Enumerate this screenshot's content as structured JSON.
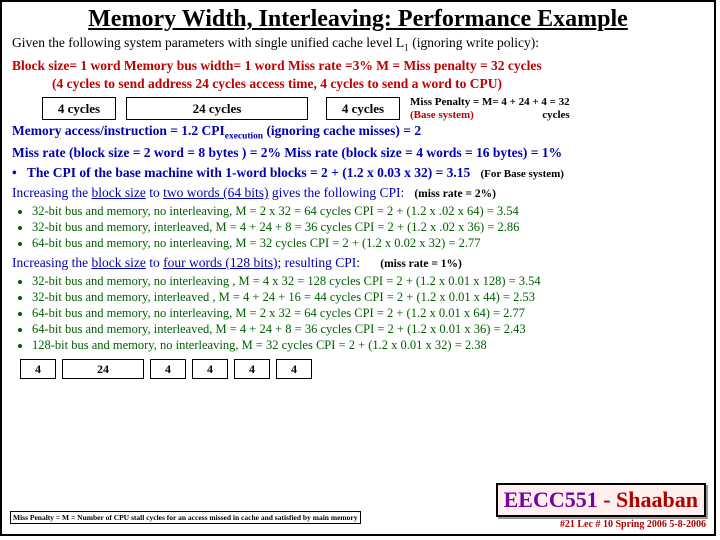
{
  "title": "Memory Width, Interleaving: Performance Example",
  "given": {
    "part1": "Given the following system parameters with single unified cache level L",
    "sub": "1",
    "part2": " (ignoring write policy):"
  },
  "params": {
    "line1": "Block size= 1 word   Memory bus width= 1  word    Miss rate =3%   M = Miss penalty = 32 cycles",
    "line2": "(4 cycles to send address     24 cycles  access time,   4 cycles to send a word to CPU)"
  },
  "cyclebox": {
    "a": "4 cycles",
    "b": "24 cycles",
    "c": "4 cycles"
  },
  "penalty": {
    "line1": "Miss Penalty = M= 4 + 24 + 4 = 32",
    "line2": "cycles",
    "base": "(Base system)"
  },
  "blue": {
    "l1a": "Memory access/instruction = 1.2        CPI",
    "l1sub": "execution",
    "l1b": " (ignoring cache misses) = 2",
    "l2": "Miss rate (block size = 2 word = 8 bytes ) =  2%    Miss rate  (block size = 4 words = 16 bytes) = 1%"
  },
  "base_cpi": {
    "text": "The CPI of the base machine with 1-word blocks =  2 + (1.2 x 0.03 x 32) = 3.15",
    "note": "(For Base system)"
  },
  "inc64": {
    "p1": "Increasing the ",
    "u1": "block size",
    "p2": " to ",
    "u2": "two words (64 bits)",
    "p3": " gives the following CPI:",
    "note": "(miss rate = 2%)"
  },
  "list64": [
    "32-bit bus and memory, no interleaving,   M = 2 x 32 = 64 cycles             CPI = 2 + (1.2 x  .02 x 64) = 3.54",
    "32-bit bus and memory, interleaved,    M = 4 + 24 + 8  = 36 cycles           CPI = 2 + (1.2 x  .02 x 36) =  2.86",
    "64-bit bus and memory, no interleaving,     M = 32 cycles                        CPI = 2 + (1.2 x 0.02 x 32) =  2.77"
  ],
  "inc128": {
    "p1": "Increasing the ",
    "u1": "block size",
    "p2": " to ",
    "u2": "four words (128 bits)",
    "p3": "; resulting CPI:",
    "note": "(miss rate = 1%)"
  },
  "list128": [
    "32-bit bus and memory, no interleaving ,   M = 4 x 32 = 128 cycles    CPI = 2 + (1.2 x 0.01 x 128) =  3.54",
    "32-bit bus and memory, interleaved ,   M = 4 + 24 + 16 =  44 cycles    CPI = 2 + (1.2 x 0.01 x 44)  =  2.53",
    "64-bit bus and memory, no interleaving,   M = 2 x 32 =   64 cycles      CPI = 2 + (1.2 x 0.01 x 64) =  2.77",
    "64-bit bus and memory, interleaved,    M = 4 + 24 + 8  =  36 cycles     CPI = 2 + (1.2 x 0.01 x 36) =  2.43",
    "128-bit bus and memory, no interleaving,   M =  32 cycles                   CPI = 2 + (1.2 x 0.01 x 32) =  2.38"
  ],
  "boxrow2": [
    "4",
    "24",
    "4",
    "4",
    "4",
    "4"
  ],
  "tiny_note": "Miss Penalty = M = Number of CPU stall cycles for an access missed in cache and satisfied by main memory",
  "footer": {
    "course": "EECC551",
    "dash": "-",
    "author": "Shaaban",
    "lec": "#21  Lec # 10  Spring 2006  5-8-2006"
  }
}
